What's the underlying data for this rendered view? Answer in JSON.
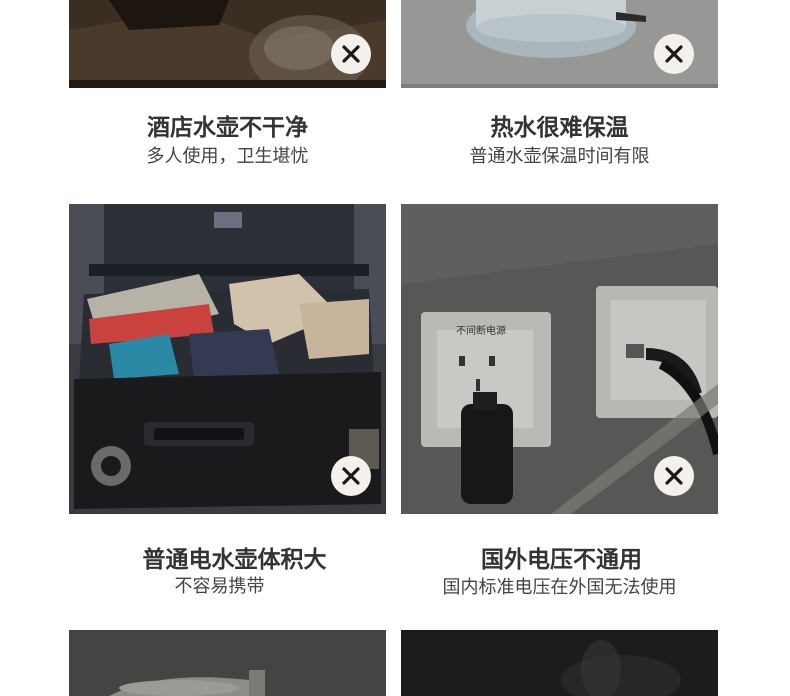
{
  "cards": [
    {
      "title": "酒店水壶不干净",
      "subtitle": "多人使用，卫生堪忧",
      "badge_icon": "close-icon"
    },
    {
      "title": "热水很难保温",
      "subtitle": "普通水壶保温时间有限",
      "badge_icon": "close-icon"
    },
    {
      "title": "普通电水壶体积大",
      "subtitle": "不容易携带",
      "badge_icon": "close-icon"
    },
    {
      "title": "国外电压不通用",
      "subtitle": "国内标准电压在外国无法使用",
      "badge_icon": "close-icon"
    }
  ],
  "socket_label": "不间断电源",
  "colors": {
    "badge_bg": "#f4f1ec",
    "badge_icon": "#1a1a1a",
    "title": "#333333",
    "subtitle": "#444444"
  }
}
